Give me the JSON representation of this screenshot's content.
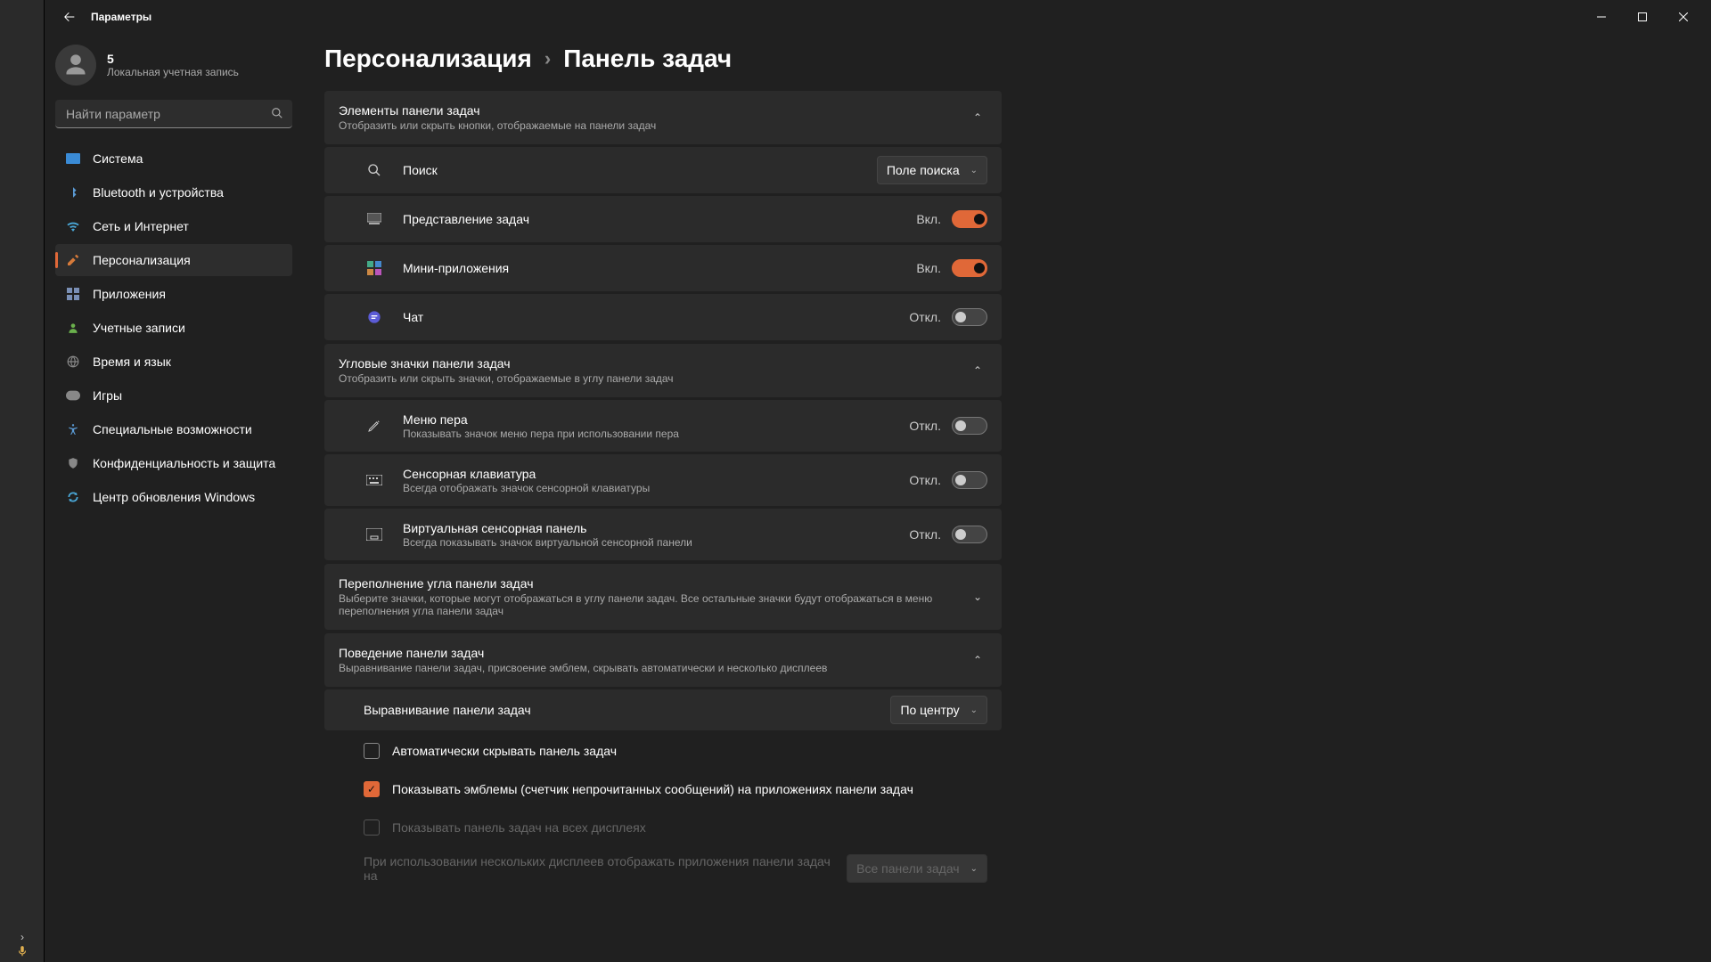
{
  "app_title": "Параметры",
  "account": {
    "name": "5",
    "sub": "Локальная учетная запись"
  },
  "search": {
    "placeholder": "Найти параметр"
  },
  "nav": [
    {
      "label": "Система",
      "icon": "🖥️"
    },
    {
      "label": "Bluetooth и устройства",
      "icon": "bt"
    },
    {
      "label": "Сеть и Интернет",
      "icon": "📶"
    },
    {
      "label": "Персонализация",
      "icon": "🖌️",
      "active": true
    },
    {
      "label": "Приложения",
      "icon": "▦"
    },
    {
      "label": "Учетные записи",
      "icon": "👤"
    },
    {
      "label": "Время и язык",
      "icon": "🌐"
    },
    {
      "label": "Игры",
      "icon": "🎮"
    },
    {
      "label": "Специальные возможности",
      "icon": "acc"
    },
    {
      "label": "Конфиденциальность и защита",
      "icon": "🛡️"
    },
    {
      "label": "Центр обновления Windows",
      "icon": "🔄"
    }
  ],
  "breadcrumb": {
    "root": "Персонализация",
    "leaf": "Панель задач"
  },
  "sections": {
    "items": {
      "title": "Элементы панели задач",
      "sub": "Отобразить или скрыть кнопки, отображаемые на панели задач",
      "rows": {
        "search": {
          "label": "Поиск",
          "dropdown": "Поле поиска"
        },
        "taskview": {
          "label": "Представление задач",
          "state": "Вкл.",
          "on": true
        },
        "widgets": {
          "label": "Мини-приложения",
          "state": "Вкл.",
          "on": true
        },
        "chat": {
          "label": "Чат",
          "state": "Откл.",
          "on": false
        }
      }
    },
    "corner": {
      "title": "Угловые значки панели задач",
      "sub": "Отобразить или скрыть значки, отображаемые в углу панели задач",
      "rows": {
        "pen": {
          "label": "Меню пера",
          "sub": "Показывать значок меню пера при использовании пера",
          "state": "Откл.",
          "on": false
        },
        "touchkb": {
          "label": "Сенсорная клавиатура",
          "sub": "Всегда отображать значок сенсорной клавиатуры",
          "state": "Откл.",
          "on": false
        },
        "touchpad": {
          "label": "Виртуальная сенсорная панель",
          "sub": "Всегда показывать значок виртуальной сенсорной панели",
          "state": "Откл.",
          "on": false
        }
      }
    },
    "overflow": {
      "title": "Переполнение угла панели задач",
      "sub": "Выберите значки, которые могут отображаться в углу панели задач. Все остальные значки будут отображаться в меню переполнения угла панели задач"
    },
    "behavior": {
      "title": "Поведение панели задач",
      "sub": "Выравнивание панели задач, присвоение эмблем, скрывать автоматически и несколько дисплеев",
      "align": {
        "label": "Выравнивание панели задач",
        "dropdown": "По центру"
      },
      "autohide": {
        "label": "Автоматически скрывать панель задач"
      },
      "badges": {
        "label": "Показывать эмблемы (счетчик непрочитанных сообщений) на приложениях панели задач"
      },
      "alldisplays": {
        "label": "Показывать панель задач на всех дисплеях"
      },
      "multi": {
        "label": "При использовании нескольких дисплеев отображать приложения панели задач на",
        "dropdown": "Все панели задач"
      }
    }
  },
  "colors": {
    "accent": "#e06838"
  }
}
